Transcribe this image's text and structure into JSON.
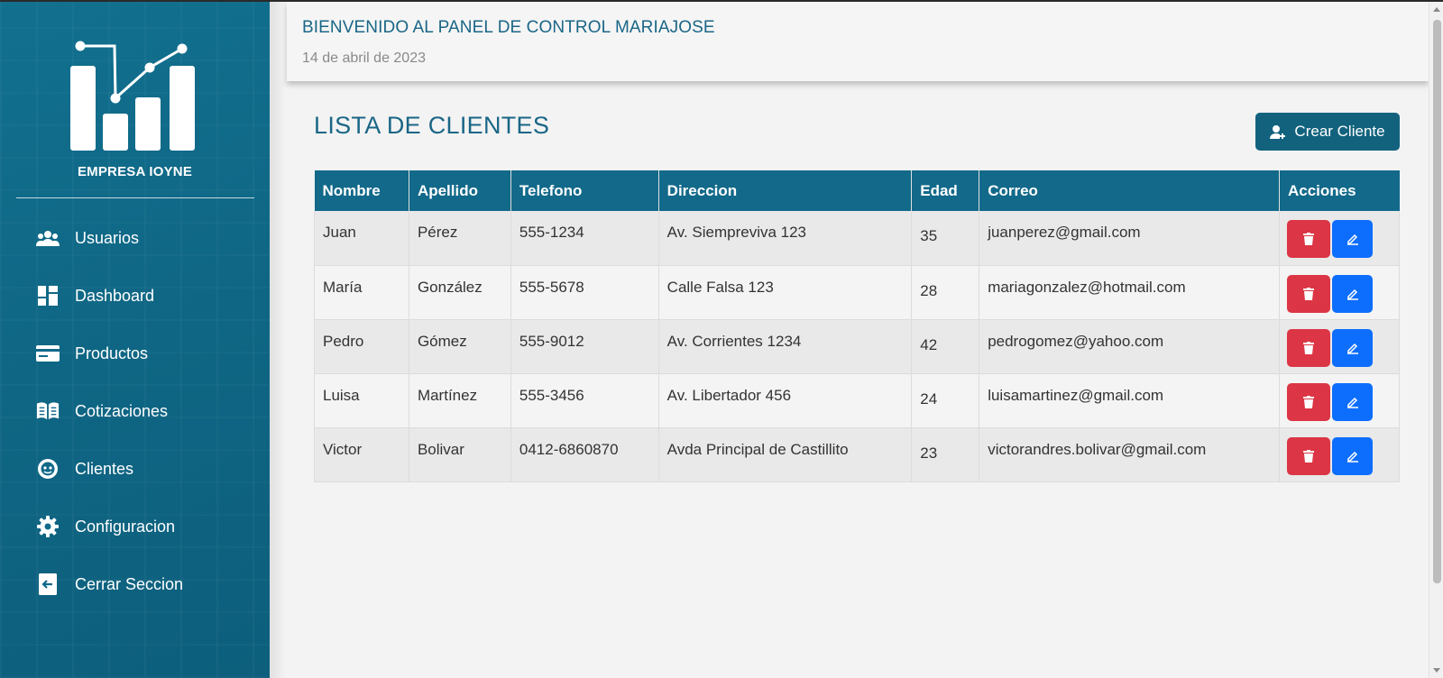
{
  "sidebar": {
    "company": "EMPRESA IOYNE",
    "items": [
      {
        "label": "Usuarios",
        "icon": "users-icon"
      },
      {
        "label": "Dashboard",
        "icon": "dashboard-icon"
      },
      {
        "label": "Productos",
        "icon": "credit-card-icon"
      },
      {
        "label": "Cotizaciones",
        "icon": "book-icon"
      },
      {
        "label": "Clientes",
        "icon": "support-agent-icon"
      },
      {
        "label": "Configuracion",
        "icon": "gear-icon"
      },
      {
        "label": "Cerrar Seccion",
        "icon": "logout-icon"
      }
    ]
  },
  "header": {
    "title": "BIENVENIDO AL PANEL DE CONTROL MARIAJOSE",
    "date": "14 de abril de 2023"
  },
  "main": {
    "title": "LISTA DE CLIENTES",
    "create_label": "Crear Cliente"
  },
  "table": {
    "columns": [
      "Nombre",
      "Apellido",
      "Telefono",
      "Direccion",
      "Edad",
      "Correo",
      "Acciones"
    ],
    "rows": [
      [
        "Juan",
        "Pérez",
        "555-1234",
        "Av. Siempreviva 123",
        "35",
        "juanperez@gmail.com"
      ],
      [
        "María",
        "González",
        "555-5678",
        "Calle Falsa 123",
        "28",
        "mariagonzalez@hotmail.com"
      ],
      [
        "Pedro",
        "Gómez",
        "555-9012",
        "Av. Corrientes 1234",
        "42",
        "pedrogomez@yahoo.com"
      ],
      [
        "Luisa",
        "Martínez",
        "555-3456",
        "Av. Libertador 456",
        "24",
        "luisamartinez@gmail.com"
      ],
      [
        "Victor",
        "Bolivar",
        "0412-6860870",
        "Avda Principal de Castillito",
        "23",
        "victorandres.bolivar@gmail.com"
      ]
    ]
  },
  "colors": {
    "primary": "#12698a",
    "delete": "#dc3545",
    "edit": "#0d6efd"
  }
}
